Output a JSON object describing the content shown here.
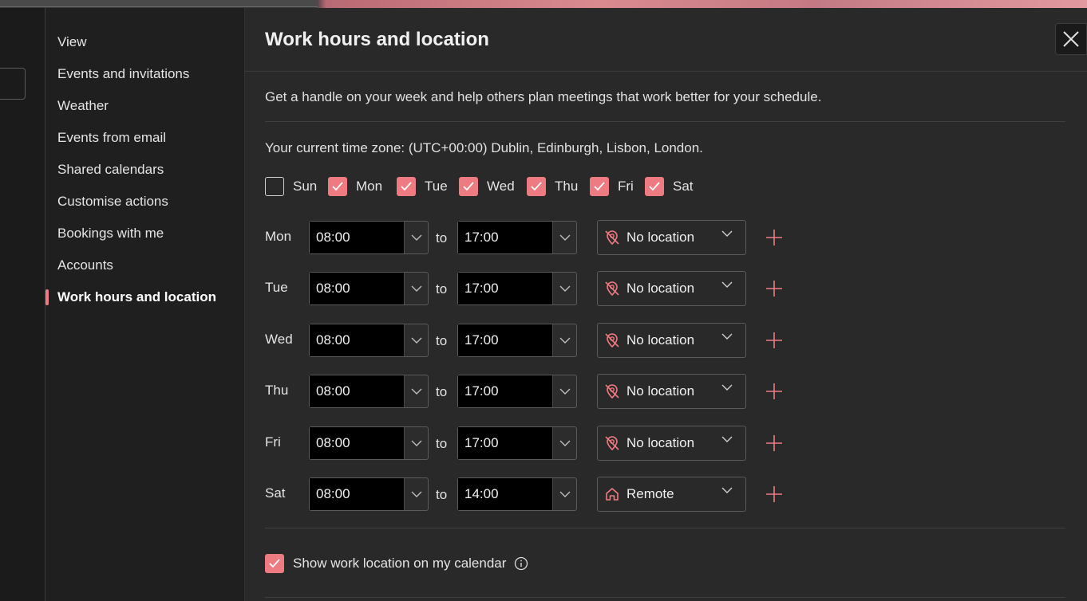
{
  "nav": {
    "items": [
      {
        "label": "View"
      },
      {
        "label": "Events and invitations"
      },
      {
        "label": "Weather"
      },
      {
        "label": "Events from email"
      },
      {
        "label": "Shared calendars"
      },
      {
        "label": "Customise actions"
      },
      {
        "label": "Bookings with me"
      },
      {
        "label": "Accounts"
      },
      {
        "label": "Work hours and location",
        "active": true
      }
    ]
  },
  "panel": {
    "title": "Work hours and location",
    "intro": "Get a handle on your week and help others plan meetings that work better for your schedule.",
    "timezone": "Your current time zone: (UTC+00:00) Dublin, Edinburgh, Lisbon, London."
  },
  "days": [
    {
      "label": "Sun",
      "checked": false
    },
    {
      "label": "Mon",
      "checked": true
    },
    {
      "label": "Tue",
      "checked": true
    },
    {
      "label": "Wed",
      "checked": true
    },
    {
      "label": "Thu",
      "checked": true
    },
    {
      "label": "Fri",
      "checked": true
    },
    {
      "label": "Sat",
      "checked": true
    }
  ],
  "schedule": [
    {
      "day": "Mon",
      "start": "08:00",
      "to": "to",
      "end": "17:00",
      "location": "No location",
      "location_icon": "no-location-icon"
    },
    {
      "day": "Tue",
      "start": "08:00",
      "to": "to",
      "end": "17:00",
      "location": "No location",
      "location_icon": "no-location-icon"
    },
    {
      "day": "Wed",
      "start": "08:00",
      "to": "to",
      "end": "17:00",
      "location": "No location",
      "location_icon": "no-location-icon"
    },
    {
      "day": "Thu",
      "start": "08:00",
      "to": "to",
      "end": "17:00",
      "location": "No location",
      "location_icon": "no-location-icon"
    },
    {
      "day": "Fri",
      "start": "08:00",
      "to": "to",
      "end": "17:00",
      "location": "No location",
      "location_icon": "no-location-icon"
    },
    {
      "day": "Sat",
      "start": "08:00",
      "to": "to",
      "end": "14:00",
      "location": "Remote",
      "location_icon": "home-icon"
    }
  ],
  "show_location": {
    "label": "Show work location on my calendar",
    "checked": true
  },
  "colors": {
    "accent": "#ef7b82",
    "panel_bg": "#292929",
    "nav_bg": "#1f1f1f"
  }
}
